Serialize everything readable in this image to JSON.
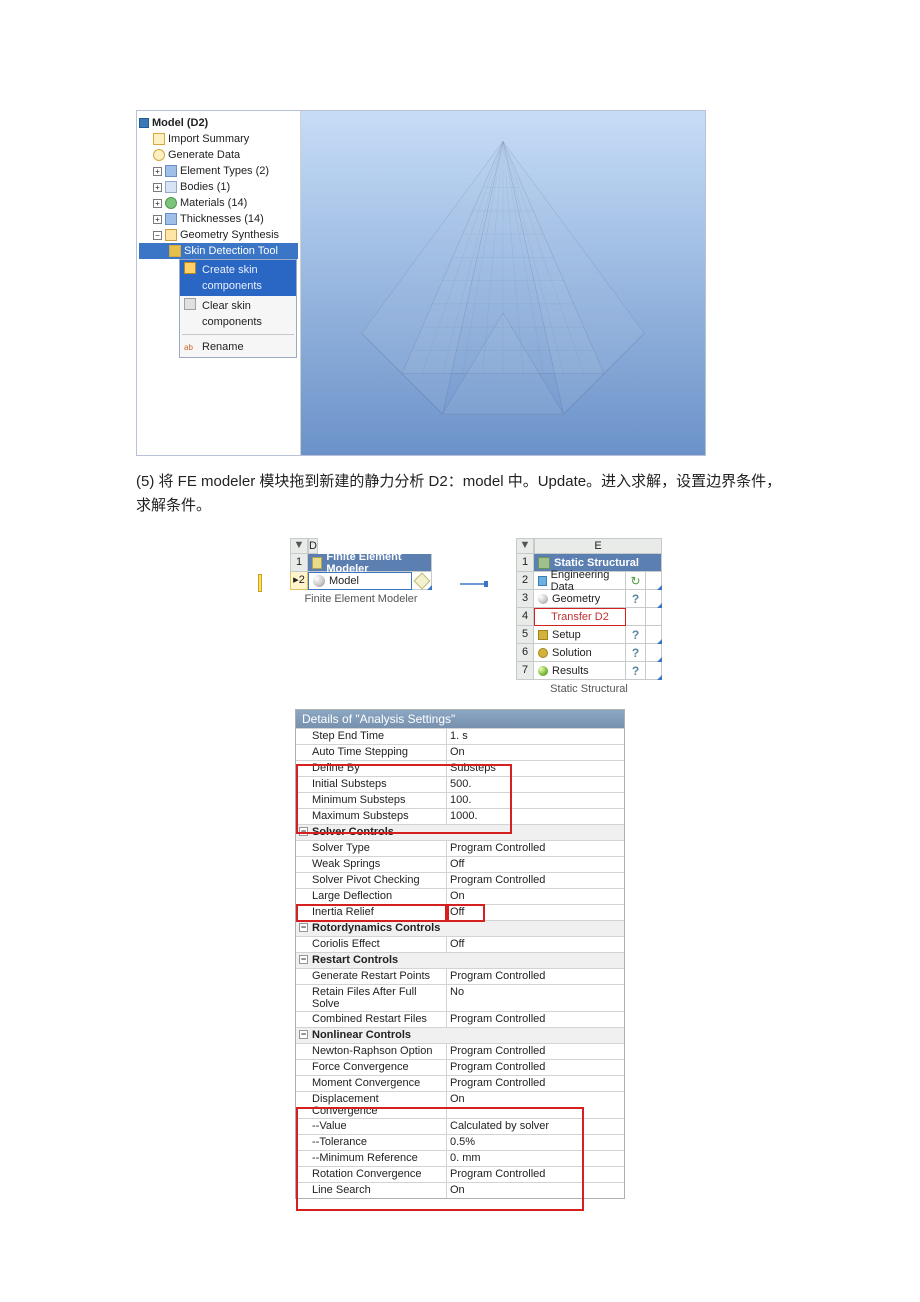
{
  "tree": {
    "root": "Model (D2)",
    "items": [
      "Import Summary",
      "Generate Data",
      "Element Types (2)",
      "Bodies (1)",
      "Materials (14)",
      "Thicknesses (14)",
      "Geometry Synthesis"
    ],
    "sub": "Skin Detection Tool"
  },
  "ctx": {
    "create": "Create skin components",
    "clear": "Clear skin components",
    "rename": "Rename"
  },
  "doc_text": "(5)  将 FE modeler 模块拖到新建的静力分析 D2：model 中。Update。进入求解，设置边界条件，求解条件。",
  "wbD": {
    "col": "D",
    "title": "Finite Element Modeler",
    "model": "Model",
    "caption": "Finite Element Modeler"
  },
  "wbE": {
    "col": "E",
    "title": "Static Structural",
    "eng": "Engineering Data",
    "geo": "Geometry",
    "transfer": "Transfer D2",
    "setup": "Setup",
    "solution": "Solution",
    "results": "Results",
    "caption": "Static Structural"
  },
  "details": {
    "title": "Details of \"Analysis Settings\"",
    "rows": [
      {
        "l": "Step End Time",
        "r": "1. s"
      },
      {
        "l": "Auto Time Stepping",
        "r": "On"
      },
      {
        "l": "Define By",
        "r": "Substeps"
      },
      {
        "l": "Initial Substeps",
        "r": "500."
      },
      {
        "l": "Minimum Substeps",
        "r": "100."
      },
      {
        "l": "Maximum Substeps",
        "r": "1000."
      }
    ],
    "cat1": "Solver Controls",
    "rows2": [
      {
        "l": "Solver Type",
        "r": "Program Controlled"
      },
      {
        "l": "Weak Springs",
        "r": "Off"
      },
      {
        "l": "Solver Pivot Checking",
        "r": "Program Controlled"
      },
      {
        "l": "Large Deflection",
        "r": "On"
      },
      {
        "l": "Inertia Relief",
        "r": "Off"
      }
    ],
    "cat2": "Rotordynamics Controls",
    "rows3": [
      {
        "l": "Coriolis Effect",
        "r": "Off"
      }
    ],
    "cat3": "Restart Controls",
    "rows4": [
      {
        "l": "Generate Restart Points",
        "r": "Program Controlled"
      },
      {
        "l": "Retain Files After Full Solve",
        "r": "No"
      },
      {
        "l": "Combined Restart Files",
        "r": "Program Controlled"
      }
    ],
    "cat4": "Nonlinear Controls",
    "rows5": [
      {
        "l": "Newton-Raphson Option",
        "r": "Program Controlled"
      },
      {
        "l": "Force Convergence",
        "r": "Program Controlled"
      },
      {
        "l": "Moment Convergence",
        "r": "Program Controlled"
      },
      {
        "l": "Displacement Convergence",
        "r": "On"
      },
      {
        "l": "--Value",
        "r": "Calculated by solver"
      },
      {
        "l": "--Tolerance",
        "r": "0.5%"
      },
      {
        "l": "--Minimum Reference",
        "r": "0. mm"
      },
      {
        "l": "Rotation Convergence",
        "r": "Program Controlled"
      },
      {
        "l": "Line Search",
        "r": "On"
      }
    ]
  }
}
